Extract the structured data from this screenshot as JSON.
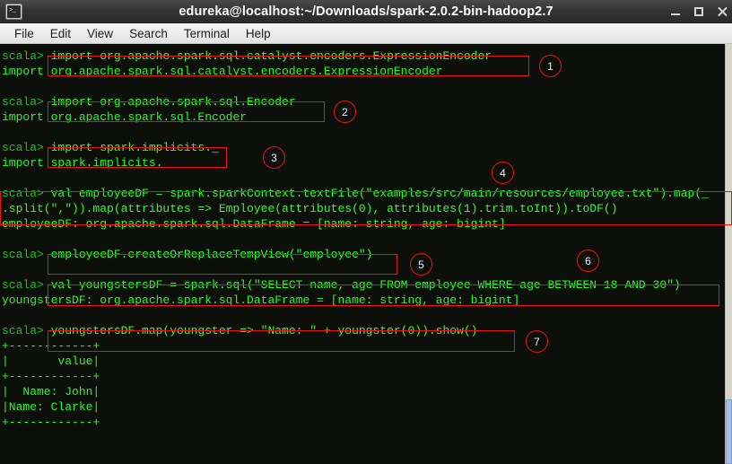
{
  "window": {
    "title": "edureka@localhost:~/Downloads/spark-2.0.2-bin-hadoop2.7",
    "icon_name": "terminal-icon",
    "prompt_glyph": ">_",
    "buttons": {
      "minimize": "minimize",
      "maximize": "maximize",
      "close": "close"
    }
  },
  "menu": {
    "items": [
      "File",
      "Edit",
      "View",
      "Search",
      "Terminal",
      "Help"
    ]
  },
  "terminal": {
    "prompt": "scala> ",
    "lines": [
      {
        "type": "prompt",
        "prompt": "scala> ",
        "text": "import org.apache.spark.sql.catalyst.encoders.ExpressionEncoder"
      },
      {
        "type": "output",
        "text": "import org.apache.spark.sql.catalyst.encoders.ExpressionEncoder"
      },
      {
        "type": "blank",
        "text": ""
      },
      {
        "type": "prompt",
        "prompt": "scala> ",
        "text": "import org.apache.spark.sql.Encoder"
      },
      {
        "type": "output",
        "text": "import org.apache.spark.sql.Encoder"
      },
      {
        "type": "blank",
        "text": ""
      },
      {
        "type": "prompt",
        "prompt": "scala> ",
        "text": "import spark.implicits._"
      },
      {
        "type": "output",
        "text": "import spark.implicits._"
      },
      {
        "type": "blank",
        "text": ""
      },
      {
        "type": "prompt",
        "prompt": "scala> ",
        "text": "val employeeDF = spark.sparkContext.textFile(\"examples/src/main/resources/employee.txt\").map(_"
      },
      {
        "type": "cont",
        "text": ".split(\",\")).map(attributes => Employee(attributes(0), attributes(1).trim.toInt)).toDF()"
      },
      {
        "type": "output",
        "text": "employeeDF: org.apache.spark.sql.DataFrame = [name: string, age: bigint]"
      },
      {
        "type": "blank",
        "text": ""
      },
      {
        "type": "prompt",
        "prompt": "scala> ",
        "text": "employeeDF.createOrReplaceTempView(\"employee\")"
      },
      {
        "type": "blank",
        "text": ""
      },
      {
        "type": "prompt",
        "prompt": "scala> ",
        "text": "val youngstersDF = spark.sql(\"SELECT name, age FROM employee WHERE age BETWEEN 18 AND 30\")"
      },
      {
        "type": "output",
        "text": "youngstersDF: org.apache.spark.sql.DataFrame = [name: string, age: bigint]"
      },
      {
        "type": "blank",
        "text": ""
      },
      {
        "type": "prompt",
        "prompt": "scala> ",
        "text": "youngstersDF.map(youngster => \"Name: \" + youngster(0)).show()"
      },
      {
        "type": "output",
        "text": "+------------+"
      },
      {
        "type": "output",
        "text": "|       value|"
      },
      {
        "type": "output",
        "text": "+------------+"
      },
      {
        "type": "output",
        "text": "|  Name: John|"
      },
      {
        "type": "output",
        "text": "|Name: Clarke|"
      },
      {
        "type": "output",
        "text": "+------------+"
      }
    ],
    "result_table": {
      "header": "value",
      "rows": [
        "Name: John",
        "Name: Clarke"
      ],
      "border": "+------------+"
    }
  },
  "annotations": {
    "color": "#ee1111",
    "callouts": [
      {
        "label": "1"
      },
      {
        "label": "2"
      },
      {
        "label": "3"
      },
      {
        "label": "4"
      },
      {
        "label": "5"
      },
      {
        "label": "6"
      },
      {
        "label": "7"
      }
    ]
  }
}
